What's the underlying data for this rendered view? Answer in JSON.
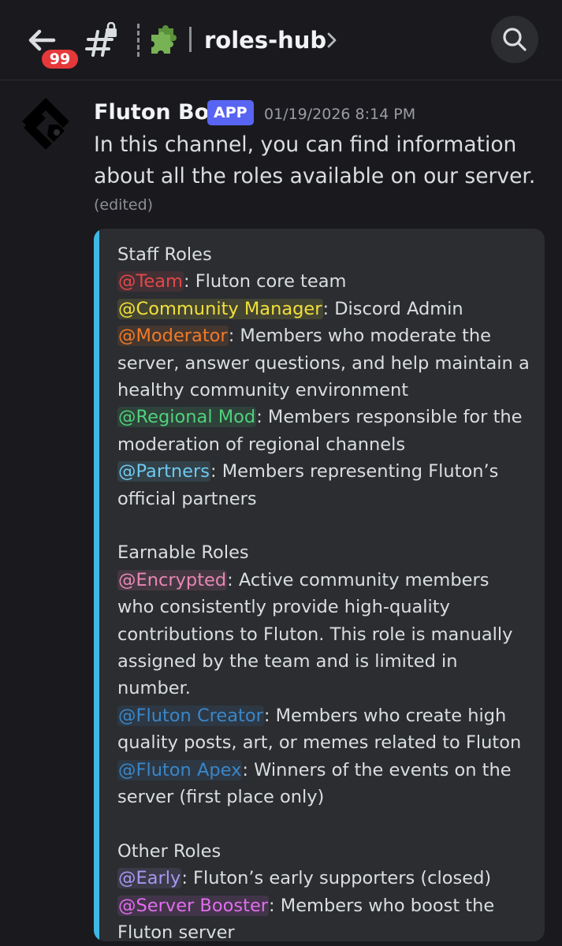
{
  "header": {
    "back_badge": "99",
    "channel_name": "roles-hub"
  },
  "message": {
    "author": "Fluton Bot",
    "app_tag": "APP",
    "timestamp": "01/19/2026 8:14 PM",
    "text_line1": "In this channel, you can find information",
    "text_line2": "about all the roles available on our server.",
    "edited": "(edited)"
  },
  "embed": {
    "accent_color": "#3fb8e3",
    "sections": {
      "staff": {
        "title": "Staff Roles",
        "team": {
          "mention": "@Team",
          "desc": ": Fluton core team",
          "color": "#e0484a"
        },
        "community_manager": {
          "mention": "@Community Manager",
          "desc": ": Discord Admin",
          "color": "#f1e03a"
        },
        "moderator": {
          "mention": "@Moderator",
          "desc_line1": ": Members who moderate the",
          "desc_line2": "server, answer questions, and help maintain a",
          "desc_line3": "healthy community environment",
          "color": "#f07a2a"
        },
        "regional_mod": {
          "mention": "@Regional Mod",
          "desc_line1": ": Members responsible for the",
          "desc_line2": "moderation of regional channels",
          "color": "#4fd17c"
        },
        "partners": {
          "mention": "@Partners",
          "desc_line1": ": Members representing Fluton’s",
          "desc_line2": "official partners",
          "color": "#6ec9ee"
        }
      },
      "earnable": {
        "title": "Earnable Roles",
        "encrypted": {
          "mention": "@Encrypted",
          "desc_line1": ": Active community members",
          "desc_line2": "who consistently provide high-quality",
          "desc_line3": "contributions to Fluton. This role is manually",
          "desc_line4": "assigned by the team and is limited in number.",
          "color": "#e887b5"
        },
        "fluton_creator": {
          "mention": "@Fluton Creator",
          "desc_line1": ": Members who create high",
          "desc_line2": "quality posts, art, or memes related to Fluton",
          "color": "#3a86c8"
        },
        "fluton_apex": {
          "mention": "@Fluton Apex",
          "desc_line1": ": Winners of the events on the",
          "desc_line2": "server (first place only)",
          "color": "#3a86c8"
        }
      },
      "other": {
        "title": "Other Roles",
        "early": {
          "mention": "@Early",
          "desc": ": Fluton’s early supporters (closed)",
          "color": "#a896f0"
        },
        "server_booster": {
          "mention": "@Server Booster",
          "desc_line1": ": Members who boost the",
          "desc_line2": "Fluton server",
          "color": "#e26cf0"
        }
      }
    }
  },
  "icons": [
    "arrow-left-icon",
    "hash-lock-icon",
    "puzzle-icon",
    "chevron-right-icon",
    "search-icon",
    "fluton-logo-icon"
  ]
}
